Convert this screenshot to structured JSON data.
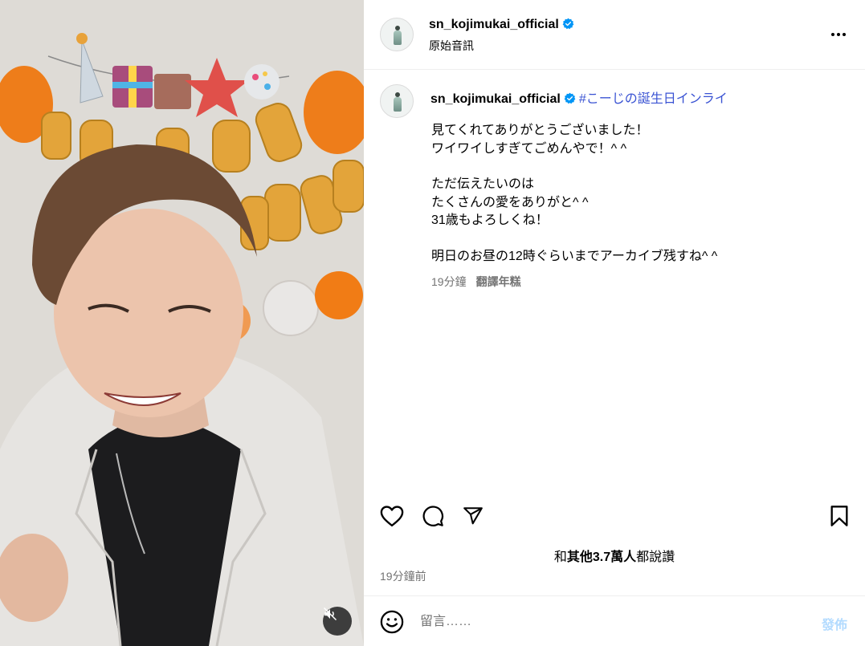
{
  "post": {
    "username": "sn_kojimukai_official",
    "audio_label": "原始音訊",
    "verified_icon": "verified-badge-icon",
    "more_icon": "more-options-icon"
  },
  "caption": {
    "username": "sn_kojimukai_official",
    "hashtag": "#こーじの誕生日インライ",
    "lines": [
      "見てくれてありがとうございました！",
      "ワイワイしすぎてごめんやで！^ ^",
      "",
      "ただ伝えたいのは",
      "たくさんの愛をありがと^ ^",
      "31歳もよろしくね！",
      "",
      "明日のお昼の12時ぐらいまでアーカイブ残すね^ ^"
    ],
    "time": "19分鐘",
    "translate_label": "翻譯年糕"
  },
  "actions": {
    "like_icon": "heart-icon",
    "comment_icon": "comment-icon",
    "share_icon": "share-icon",
    "save_icon": "bookmark-icon"
  },
  "likes": {
    "prefix": "和",
    "count": "其他3.7萬人",
    "suffix": "都說讚"
  },
  "timestamp": "19分鐘前",
  "comment": {
    "emoji_icon": "emoji-icon",
    "placeholder": "留言……",
    "post_label": "發佈"
  },
  "media": {
    "mute_icon": "muted-speaker-icon"
  },
  "colors": {
    "accent": "#0095f6",
    "verified": "#0095f6",
    "hashtag": "#3a53d3",
    "secondary_text": "#737373",
    "post_button_disabled": "#b3dbff"
  }
}
